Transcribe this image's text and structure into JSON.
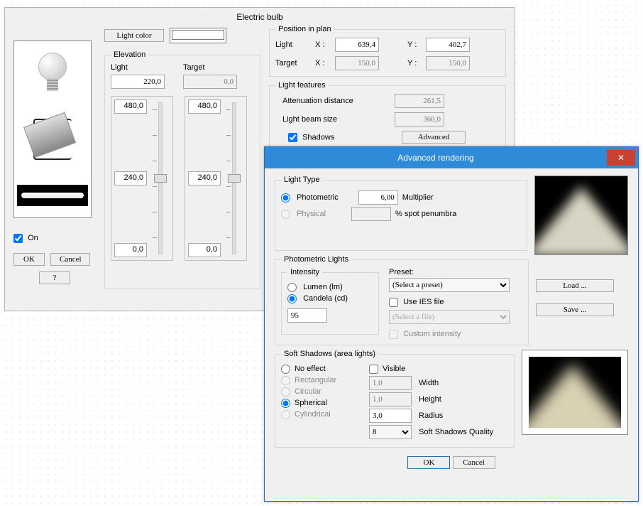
{
  "bulb": {
    "title": "Electric bulb",
    "light_color_btn": "Light color",
    "elevation": {
      "legend": "Elevation",
      "light_label": "Light",
      "target_label": "Target",
      "light_value": "220,0",
      "target_value": "0,0",
      "slider1_top": "480,0",
      "slider1_mid": "240,0",
      "slider1_bot": "0,0",
      "slider2_top": "480,0",
      "slider2_mid": "240,0",
      "slider2_bot": "0,0"
    },
    "position": {
      "legend": "Position in plan",
      "row1_label": "Light",
      "row2_label": "Target",
      "x_prefix": "X :",
      "y_prefix": "Y :",
      "light_x": "639,4",
      "light_y": "402,7",
      "target_x": "150,0",
      "target_y": "150,0"
    },
    "features": {
      "legend": "Light features",
      "atten_label": "Attenuation distance",
      "atten_value": "261,5",
      "beam_label": "Light beam size",
      "beam_value": "360,0",
      "shadows_label": "Shadows",
      "advanced_btn": "Advanced"
    },
    "on_label": "On",
    "ok_btn": "OK",
    "cancel_btn": "Cancel",
    "help_btn": "?"
  },
  "adv": {
    "title": "Advanced rendering",
    "close_glyph": "✕",
    "light_type": {
      "legend": "Light Type",
      "photometric_label": "Photometric",
      "physical_label": "Physical",
      "photometric_value": "6,00",
      "multiplier_label": "Multiplier",
      "penumbra_label": "% spot penumbra"
    },
    "photom": {
      "legend": "Photometric Lights",
      "intensity_legend": "Intensity",
      "lumen_label": "Lumen (lm)",
      "candela_label": "Candela (cd)",
      "intensity_value": "95",
      "preset_label": "Preset:",
      "preset_value": "(Select a preset)",
      "use_ies_label": "Use IES file",
      "ies_value": "(Select a file)",
      "custom_label": "Custom intensity",
      "load_btn": "Load ...",
      "save_btn": "Save ..."
    },
    "soft": {
      "legend": "Soft Shadows (area lights)",
      "noeffect_label": "No effect",
      "rectangular_label": "Rectangular",
      "circular_label": "Circular",
      "spherical_label": "Spherical",
      "cylindrical_label": "Cylindrical",
      "visible_label": "Visible",
      "width_label": "Width",
      "height_label": "Height",
      "radius_label": "Radius",
      "quality_label": "Soft Shadows Quality",
      "width_value": "1,0",
      "height_value": "1,0",
      "radius_value": "3,0",
      "quality_value": "8"
    },
    "ok_btn": "OK",
    "cancel_btn": "Cancel"
  }
}
